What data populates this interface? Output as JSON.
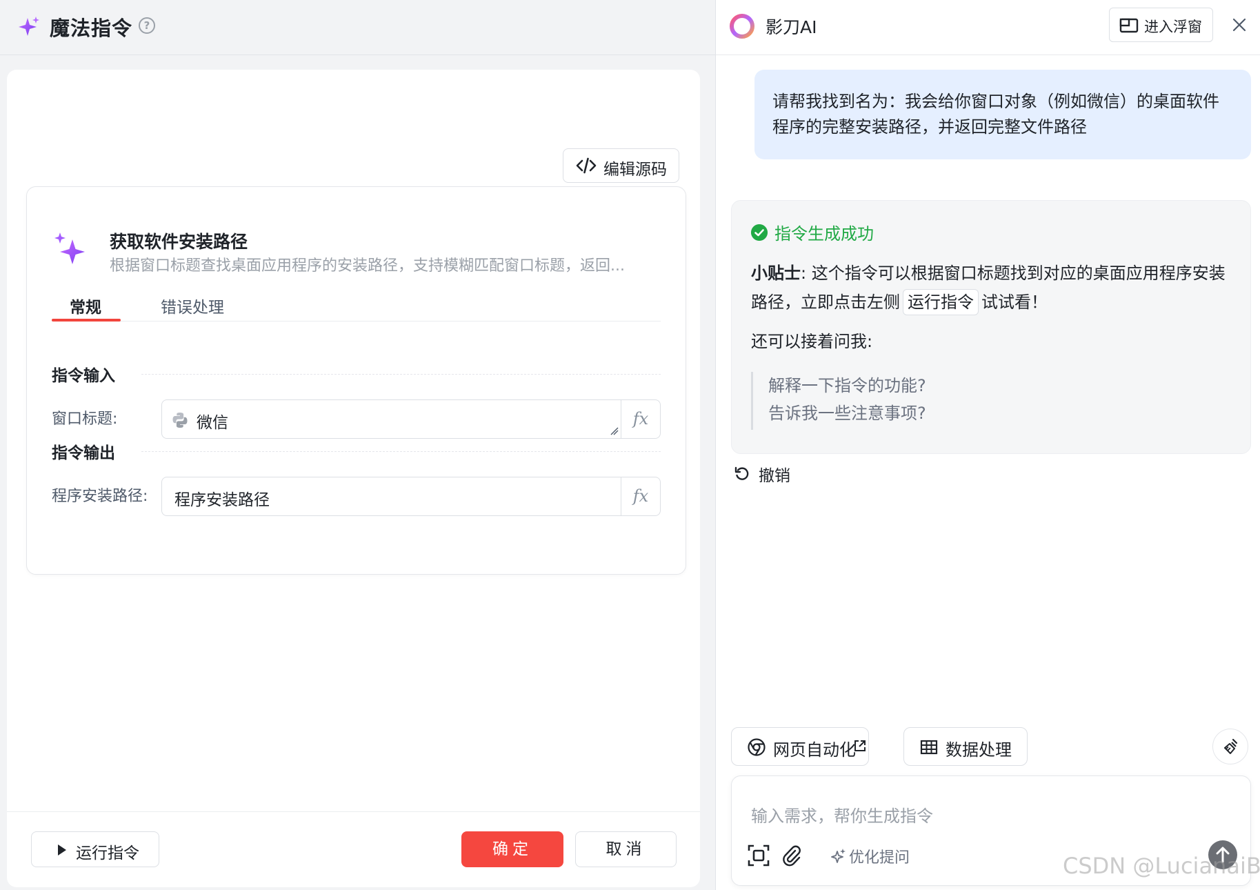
{
  "left": {
    "header": {
      "title": "魔法指令",
      "help": "?"
    },
    "edit_source_label": "编辑源码",
    "card": {
      "title": "获取软件安装路径",
      "description": "根据窗口标题查找桌面应用程序的安装路径，支持模糊匹配窗口标题，返回...",
      "tabs": [
        {
          "label": "常规",
          "active": true
        },
        {
          "label": "错误处理",
          "active": false
        }
      ],
      "input_section": "指令输入",
      "output_section": "指令输出",
      "fields": [
        {
          "label": "窗口标题:",
          "value": "微信",
          "icon": "python-icon"
        },
        {
          "label": "程序安装路径:",
          "value": "程序安装路径"
        }
      ],
      "fx": "fx"
    },
    "footer": {
      "run_label": "运行指令",
      "ok_label": "确定",
      "cancel_label": "取消"
    }
  },
  "right": {
    "header": {
      "brand": "影刀AI",
      "float_label": "进入浮窗"
    },
    "user_message": "请帮我找到名为：我会给你窗口对象（例如微信）的桌面软件程序的完整安装路径，并返回完整文件路径",
    "ai": {
      "status": "指令生成成功",
      "tip_bold": "小贴士",
      "tip_text_1": ": 这个指令可以根据窗口标题找到对应的桌面应用程序安装路径，立即点击左侧",
      "tip_chip": "运行指令",
      "tip_text_2": "试试看！",
      "more": "还可以接着问我:",
      "suggestions": [
        "解释一下指令的功能?",
        "告诉我一些注意事项?"
      ]
    },
    "undo_label": "撤销",
    "quick_actions": [
      {
        "label": "网页自动化",
        "icon": "chrome-icon"
      },
      {
        "label": "数据处理",
        "icon": "table-icon"
      }
    ],
    "input": {
      "placeholder": "输入需求，帮你生成指令",
      "optimize_label": "优化提问"
    }
  },
  "watermark": "CSDN @LucianaiB",
  "colors": {
    "accent_red": "#f5473f",
    "success_green": "#21a945",
    "user_bubble": "#e5efff",
    "spark_purple": "#9b4dea"
  }
}
